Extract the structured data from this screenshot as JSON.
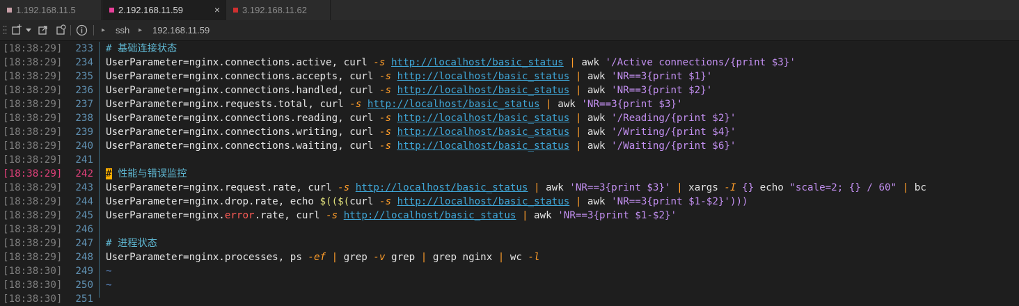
{
  "tabs": [
    {
      "label": "1.192.168.11.5",
      "color": "#c9a0a8",
      "active": false
    },
    {
      "label": "2.192.168.11.59",
      "color": "#e8409a",
      "active": true,
      "close": "×"
    },
    {
      "label": "3.192.168.11.62",
      "color": "#d03030",
      "active": false
    }
  ],
  "toolbar": {
    "protocol": "ssh",
    "host": "192.168.11.59",
    "arrow1": "▸",
    "arrow2": "▸"
  },
  "terminal": {
    "lines": [
      {
        "ts": "[18:38:29]",
        "ln": "233",
        "parts": [
          {
            "t": "# 基础连接状态",
            "c": "cmt"
          }
        ]
      },
      {
        "ts": "[18:38:29]",
        "ln": "234",
        "parts": [
          {
            "t": "UserParameter=nginx.connections.active, curl "
          },
          {
            "t": "-s",
            "c": "flag"
          },
          {
            "t": " "
          },
          {
            "t": "http://localhost/basic_status",
            "c": "url"
          },
          {
            "t": " "
          },
          {
            "t": "|",
            "c": "sep"
          },
          {
            "t": " awk "
          },
          {
            "t": "'/Active connections/{print $3}'",
            "c": "str"
          }
        ]
      },
      {
        "ts": "[18:38:29]",
        "ln": "235",
        "parts": [
          {
            "t": "UserParameter=nginx.connections.accepts, curl "
          },
          {
            "t": "-s",
            "c": "flag"
          },
          {
            "t": " "
          },
          {
            "t": "http://localhost/basic_status",
            "c": "url"
          },
          {
            "t": " "
          },
          {
            "t": "|",
            "c": "sep"
          },
          {
            "t": " awk "
          },
          {
            "t": "'NR==3{print $1}'",
            "c": "str"
          }
        ]
      },
      {
        "ts": "[18:38:29]",
        "ln": "236",
        "parts": [
          {
            "t": "UserParameter=nginx.connections.handled, curl "
          },
          {
            "t": "-s",
            "c": "flag"
          },
          {
            "t": " "
          },
          {
            "t": "http://localhost/basic_status",
            "c": "url"
          },
          {
            "t": " "
          },
          {
            "t": "|",
            "c": "sep"
          },
          {
            "t": " awk "
          },
          {
            "t": "'NR==3{print $2}'",
            "c": "str"
          }
        ]
      },
      {
        "ts": "[18:38:29]",
        "ln": "237",
        "parts": [
          {
            "t": "UserParameter=nginx.requests.total, curl "
          },
          {
            "t": "-s",
            "c": "flag"
          },
          {
            "t": " "
          },
          {
            "t": "http://localhost/basic_status",
            "c": "url"
          },
          {
            "t": " "
          },
          {
            "t": "|",
            "c": "sep"
          },
          {
            "t": " awk "
          },
          {
            "t": "'NR==3{print $3}'",
            "c": "str"
          }
        ]
      },
      {
        "ts": "[18:38:29]",
        "ln": "238",
        "parts": [
          {
            "t": "UserParameter=nginx.connections.reading, curl "
          },
          {
            "t": "-s",
            "c": "flag"
          },
          {
            "t": " "
          },
          {
            "t": "http://localhost/basic_status",
            "c": "url"
          },
          {
            "t": " "
          },
          {
            "t": "|",
            "c": "sep"
          },
          {
            "t": " awk "
          },
          {
            "t": "'/Reading/{print $2}'",
            "c": "str"
          }
        ]
      },
      {
        "ts": "[18:38:29]",
        "ln": "239",
        "parts": [
          {
            "t": "UserParameter=nginx.connections.writing, curl "
          },
          {
            "t": "-s",
            "c": "flag"
          },
          {
            "t": " "
          },
          {
            "t": "http://localhost/basic_status",
            "c": "url"
          },
          {
            "t": " "
          },
          {
            "t": "|",
            "c": "sep"
          },
          {
            "t": " awk "
          },
          {
            "t": "'/Writing/{print $4}'",
            "c": "str"
          }
        ]
      },
      {
        "ts": "[18:38:29]",
        "ln": "240",
        "parts": [
          {
            "t": "UserParameter=nginx.connections.waiting, curl "
          },
          {
            "t": "-s",
            "c": "flag"
          },
          {
            "t": " "
          },
          {
            "t": "http://localhost/basic_status",
            "c": "url"
          },
          {
            "t": " "
          },
          {
            "t": "|",
            "c": "sep"
          },
          {
            "t": " awk "
          },
          {
            "t": "'/Waiting/{print $6}'",
            "c": "str"
          }
        ]
      },
      {
        "ts": "[18:38:29]",
        "ln": "241",
        "parts": []
      },
      {
        "ts": "[18:38:29]",
        "ln": "242",
        "current": true,
        "parts": [
          {
            "t": "#",
            "c": "cmt-hl"
          },
          {
            "t": " 性能与错误监控",
            "c": "cmt"
          }
        ]
      },
      {
        "ts": "[18:38:29]",
        "ln": "243",
        "parts": [
          {
            "t": "UserParameter=nginx.request.rate, curl "
          },
          {
            "t": "-s",
            "c": "flag"
          },
          {
            "t": " "
          },
          {
            "t": "http://localhost/basic_status",
            "c": "url"
          },
          {
            "t": " "
          },
          {
            "t": "|",
            "c": "sep"
          },
          {
            "t": " awk "
          },
          {
            "t": "'NR==3{print $3}'",
            "c": "str"
          },
          {
            "t": " "
          },
          {
            "t": "|",
            "c": "sep"
          },
          {
            "t": " xargs "
          },
          {
            "t": "-I",
            "c": "flag"
          },
          {
            "t": " "
          },
          {
            "t": "{}",
            "c": "str"
          },
          {
            "t": " echo "
          },
          {
            "t": "\"scale=2; {} / 60\"",
            "c": "str"
          },
          {
            "t": " "
          },
          {
            "t": "|",
            "c": "sep"
          },
          {
            "t": " bc"
          }
        ]
      },
      {
        "ts": "[18:38:29]",
        "ln": "244",
        "parts": [
          {
            "t": "UserParameter=nginx.drop.rate, echo "
          },
          {
            "t": "$(($(",
            "c": "var"
          },
          {
            "t": "curl "
          },
          {
            "t": "-s",
            "c": "flag"
          },
          {
            "t": " "
          },
          {
            "t": "http://localhost/basic_status",
            "c": "url"
          },
          {
            "t": " "
          },
          {
            "t": "|",
            "c": "sep"
          },
          {
            "t": " awk "
          },
          {
            "t": "'NR==3{print $1-$2}'",
            "c": "str"
          },
          {
            "t": ")))",
            "c": "str"
          }
        ]
      },
      {
        "ts": "[18:38:29]",
        "ln": "245",
        "parts": [
          {
            "t": "UserParameter=nginx."
          },
          {
            "t": "error",
            "c": "red"
          },
          {
            "t": ".rate, curl "
          },
          {
            "t": "-s",
            "c": "flag"
          },
          {
            "t": " "
          },
          {
            "t": "http://localhost/basic_status",
            "c": "url"
          },
          {
            "t": " "
          },
          {
            "t": "|",
            "c": "sep"
          },
          {
            "t": " awk "
          },
          {
            "t": "'NR==3{print $1-$2}'",
            "c": "str"
          }
        ]
      },
      {
        "ts": "[18:38:29]",
        "ln": "246",
        "parts": []
      },
      {
        "ts": "[18:38:29]",
        "ln": "247",
        "parts": [
          {
            "t": "# 进程状态",
            "c": "cmt"
          }
        ]
      },
      {
        "ts": "[18:38:29]",
        "ln": "248",
        "parts": [
          {
            "t": "UserParameter=nginx.processes, ps "
          },
          {
            "t": "-ef",
            "c": "flag"
          },
          {
            "t": " "
          },
          {
            "t": "|",
            "c": "sep"
          },
          {
            "t": " grep "
          },
          {
            "t": "-v",
            "c": "flag"
          },
          {
            "t": " grep "
          },
          {
            "t": "|",
            "c": "sep"
          },
          {
            "t": " grep nginx "
          },
          {
            "t": "|",
            "c": "sep"
          },
          {
            "t": " wc "
          },
          {
            "t": "-l",
            "c": "flag"
          }
        ]
      },
      {
        "ts": "[18:38:30]",
        "ln": "249",
        "parts": [
          {
            "t": "~",
            "c": "tilde"
          }
        ]
      },
      {
        "ts": "[18:38:30]",
        "ln": "250",
        "parts": [
          {
            "t": "~",
            "c": "tilde"
          }
        ]
      },
      {
        "ts": "[18:38:30]",
        "ln": "251",
        "parts": []
      }
    ]
  },
  "colors": {
    "timestamp": "#7f7f7f",
    "line_number": "#5f8fb0",
    "current_line": "#e0407a"
  }
}
